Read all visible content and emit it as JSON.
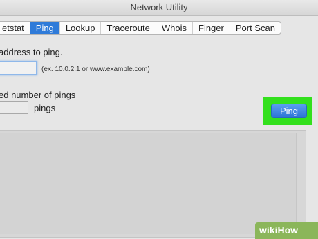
{
  "window": {
    "title": "Network Utility"
  },
  "tabs": [
    {
      "label": "etstat",
      "active": false
    },
    {
      "label": "Ping",
      "active": true
    },
    {
      "label": "Lookup",
      "active": false
    },
    {
      "label": "Traceroute",
      "active": false
    },
    {
      "label": "Whois",
      "active": false
    },
    {
      "label": "Finger",
      "active": false
    },
    {
      "label": "Port Scan",
      "active": false
    }
  ],
  "address": {
    "prompt": "address to ping.",
    "value": "",
    "hint": "(ex. 10.0.2.1 or www.example.com)"
  },
  "pings": {
    "option_label": "ed number of pings",
    "value": "",
    "unit_label": "pings"
  },
  "actions": {
    "ping_label": "Ping"
  },
  "output": {
    "text": ""
  },
  "watermark": {
    "text": "wikiHow"
  },
  "colors": {
    "accent": "#2f7bd9",
    "highlight": "#33e01d",
    "watermark": "#8bb65a"
  }
}
